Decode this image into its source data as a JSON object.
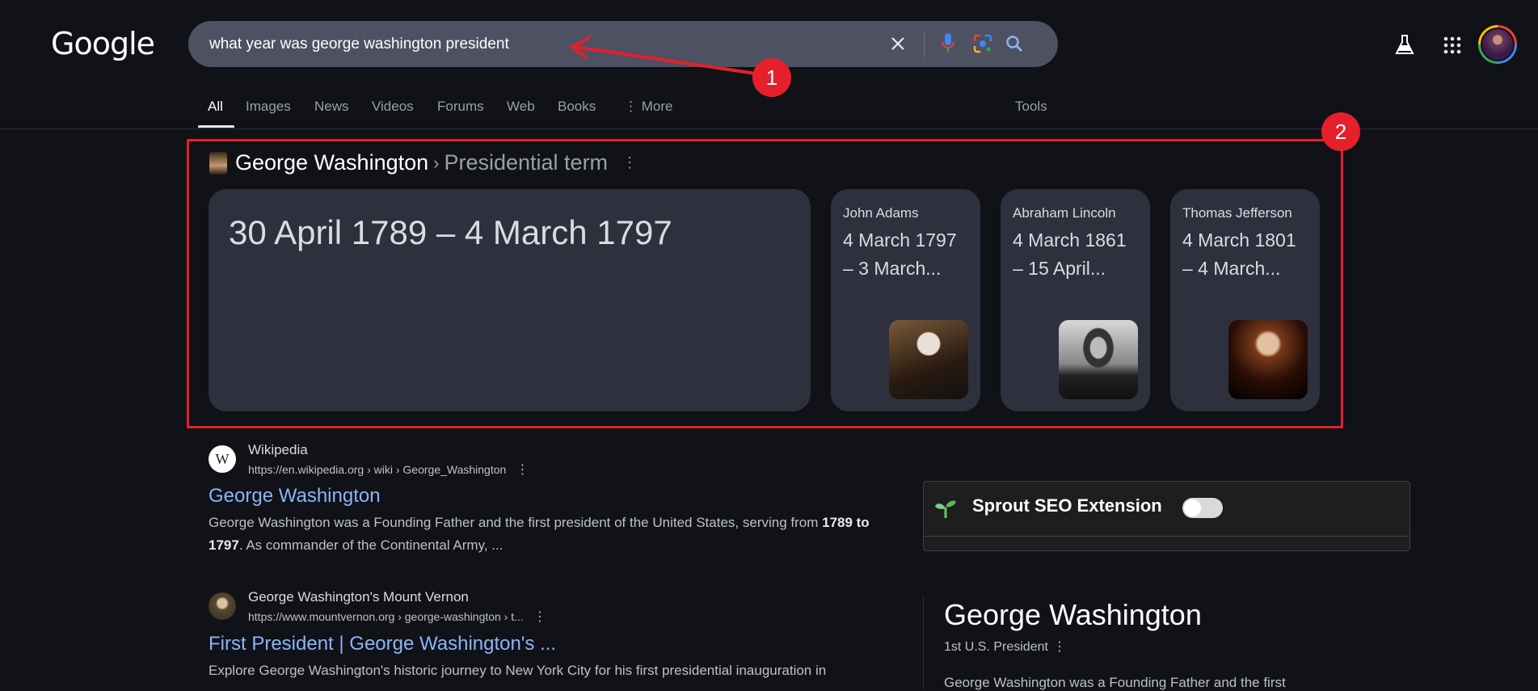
{
  "header": {
    "logo": "Google",
    "query": "what year was george washington president",
    "icons": [
      "close-icon",
      "mic-icon",
      "lens-icon",
      "search-icon",
      "labs-flask-icon",
      "apps-grid-icon",
      "avatar"
    ]
  },
  "tabs": [
    {
      "label": "All",
      "active": true
    },
    {
      "label": "Images"
    },
    {
      "label": "News"
    },
    {
      "label": "Videos"
    },
    {
      "label": "Forums"
    },
    {
      "label": "Web"
    },
    {
      "label": "Books"
    },
    {
      "label": "More"
    }
  ],
  "tools_label": "Tools",
  "annotations": {
    "badge1": "1",
    "badge2": "2",
    "color": "#e5202a"
  },
  "featured": {
    "entity": "George Washington",
    "separator": "›",
    "attribute": "Presidential term",
    "main_value": "30 April 1789 – 4 March 1797",
    "related": [
      {
        "name": "John Adams",
        "line1": "4 March 1797",
        "line2": "– 3 March..."
      },
      {
        "name": "Abraham Lincoln",
        "line1": "4 March 1861",
        "line2": "– 15 April..."
      },
      {
        "name": "Thomas Jefferson",
        "line1": "4 March 1801",
        "line2": "– 4 March..."
      }
    ]
  },
  "results": [
    {
      "source": "Wikipedia",
      "url": "https://en.wikipedia.org › wiki › George_Washington",
      "title": "George Washington",
      "snippet_pre": "George Washington was a Founding Father and the first president of the United States, serving from ",
      "snippet_bold": "1789 to 1797",
      "snippet_post": ". As commander of the Continental Army, ..."
    },
    {
      "source": "George Washington's Mount Vernon",
      "url": "https://www.mountvernon.org › george-washington › t...",
      "title": "First President | George Washington's ...",
      "snippet": "Explore George Washington's historic journey to New York City for his first presidential inauguration in"
    }
  ],
  "sprout": {
    "label": "Sprout SEO Extension",
    "toggle_on": false
  },
  "knowledge_panel": {
    "title": "George Washington",
    "subtitle": "1st U.S. President",
    "description": "George Washington was a Founding Father and the first"
  }
}
